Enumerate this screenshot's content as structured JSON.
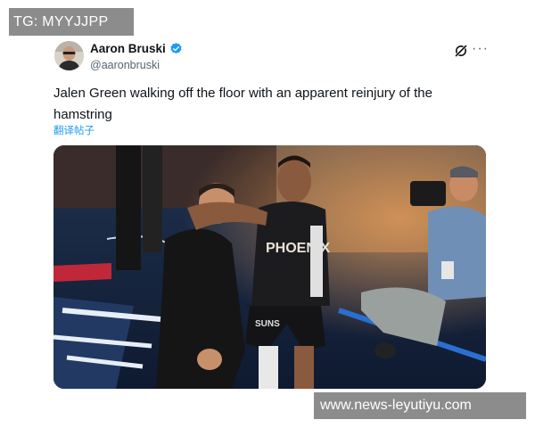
{
  "watermarks": {
    "top": "TG: MYYJJPP",
    "bottom": "www.news-leyutiyu.com"
  },
  "tweet": {
    "author_name": "Aaron Bruski",
    "handle": "@aaronbruski",
    "verified": true,
    "text": "Jalen Green walking off the floor with an apparent reinjury of the hamstring",
    "translate_label": "翻译帖子",
    "more_label": "···"
  },
  "media": {
    "jersey_text": "PHOENIX",
    "shorts_text": "SUNS"
  },
  "icons": {
    "verified": "verified-badge-icon",
    "grok": "grok-icon",
    "more": "more-options-icon"
  },
  "colors": {
    "accent": "#1d9bf0",
    "text": "#0f1419",
    "muted": "#536471",
    "watermark_bg": "#8c8c8c"
  }
}
